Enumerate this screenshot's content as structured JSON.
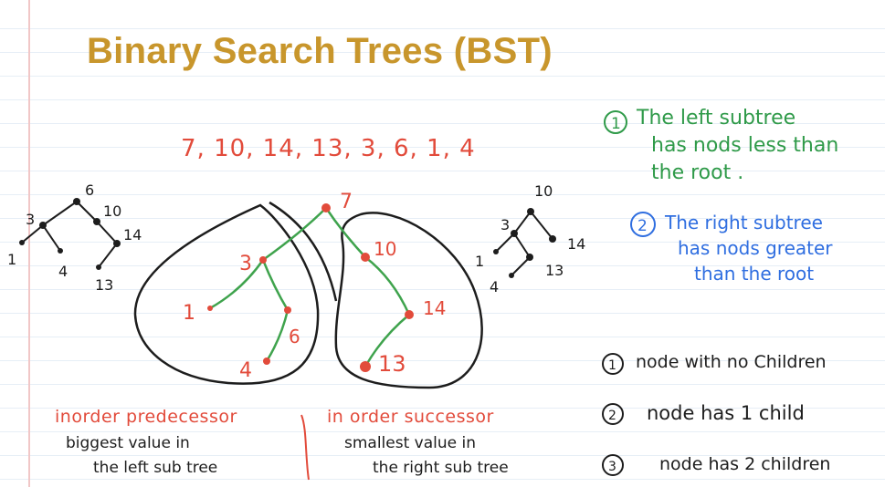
{
  "title": "Binary Search Trees (BST)",
  "sequence": "7, 10, 14, 13, 3, 6, 1, 4",
  "main_tree": {
    "root": "7",
    "left": "3",
    "right": "10",
    "left_left": "1",
    "left_right": "6",
    "left_right_left": "4",
    "right_right": "14",
    "right_right_left": "13"
  },
  "left_mini_tree": {
    "n3": "3",
    "n6": "6",
    "n10": "10",
    "n14": "14",
    "n1": "1",
    "n4": "4",
    "n13": "13"
  },
  "right_mini_tree": {
    "n10": "10",
    "n3": "3",
    "n14": "14",
    "n1": "1",
    "n4": "4",
    "n13": "13"
  },
  "properties": {
    "p1_num": "1",
    "p1_lines": [
      "The left subtree",
      "has nods less than",
      "the root ."
    ],
    "p2_num": "2",
    "p2_lines": [
      "The right subtree",
      "has nods greater",
      "than the root"
    ]
  },
  "delete_cases": [
    {
      "num": "1",
      "text": "node with no Children"
    },
    {
      "num": "2",
      "text": "node has 1 child"
    },
    {
      "num": "3",
      "text": "node has 2 children"
    }
  ],
  "predecessor": {
    "label": "inorder predecessor",
    "line1": "biggest value in",
    "line2": "the left sub tree"
  },
  "successor": {
    "label": "in order successor",
    "line1": "smallest value in",
    "line2": "the right sub tree"
  },
  "colors": {
    "title": "#c8962c",
    "red": "#e24b3b",
    "green": "#2f9a49",
    "blue": "#2f6ee0",
    "ink": "#1d1d1d"
  }
}
